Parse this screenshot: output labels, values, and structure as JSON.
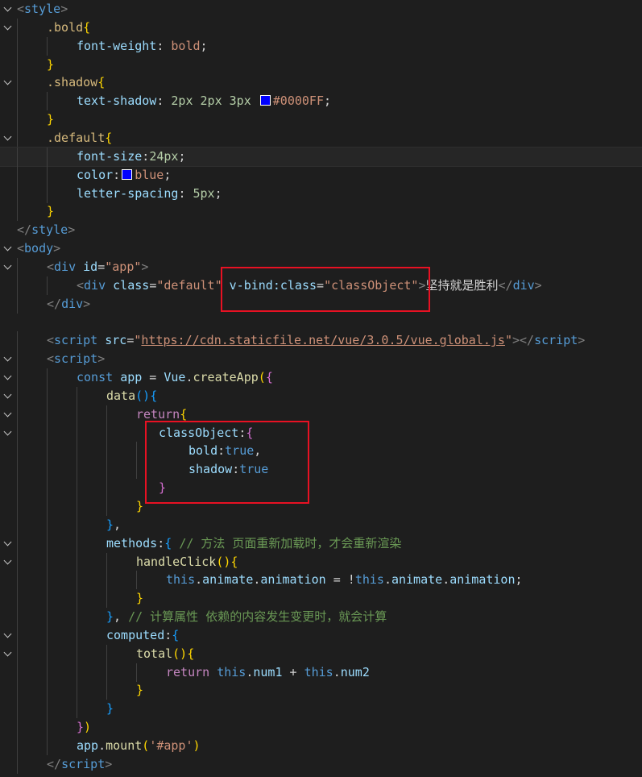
{
  "colors": {
    "swatch_shadow": "#0000FF",
    "swatch_color": "#0000ff",
    "highlight_box": "#e81123"
  },
  "icons": {
    "fold": "chevron-down-icon"
  },
  "lines": [
    {
      "fold": true,
      "indent": 0,
      "tokens": [
        [
          "t-br",
          "<"
        ],
        [
          "t-tag",
          "style"
        ],
        [
          "t-br",
          ">"
        ]
      ]
    },
    {
      "fold": true,
      "indent": 1,
      "tokens": [
        [
          "t-sel",
          ".bold"
        ],
        [
          "t-p1",
          "{"
        ]
      ]
    },
    {
      "fold": false,
      "indent": 2,
      "tokens": [
        [
          "t-prop",
          "font-weight"
        ],
        [
          "t-text",
          ": "
        ],
        [
          "t-val",
          "bold"
        ],
        [
          "t-text",
          ";"
        ]
      ]
    },
    {
      "fold": false,
      "indent": 1,
      "tokens": [
        [
          "t-p1",
          "}"
        ]
      ]
    },
    {
      "fold": true,
      "indent": 1,
      "tokens": [
        [
          "t-sel",
          ".shadow"
        ],
        [
          "t-p1",
          "{"
        ]
      ]
    },
    {
      "fold": false,
      "indent": 2,
      "tokens": [
        [
          "t-prop",
          "text-shadow"
        ],
        [
          "t-text",
          ": "
        ],
        [
          "t-num",
          "2px"
        ],
        [
          "t-text",
          " "
        ],
        [
          "t-num",
          "2px"
        ],
        [
          "t-text",
          " "
        ],
        [
          "t-num",
          "3px"
        ],
        [
          "t-text",
          " "
        ],
        [
          "swatch",
          "swatch_shadow"
        ],
        [
          "t-val",
          "#0000FF"
        ],
        [
          "t-text",
          ";"
        ]
      ]
    },
    {
      "fold": false,
      "indent": 1,
      "tokens": [
        [
          "t-p1",
          "}"
        ]
      ]
    },
    {
      "fold": true,
      "indent": 1,
      "tokens": [
        [
          "t-sel",
          ".default"
        ],
        [
          "t-p1",
          "{"
        ]
      ]
    },
    {
      "fold": false,
      "indent": 2,
      "active": true,
      "tokens": [
        [
          "t-prop",
          "font-size"
        ],
        [
          "t-text",
          ":"
        ],
        [
          "t-num",
          "24px"
        ],
        [
          "t-text",
          ";"
        ]
      ]
    },
    {
      "fold": false,
      "indent": 2,
      "tokens": [
        [
          "t-prop",
          "color"
        ],
        [
          "t-text",
          ":"
        ],
        [
          "swatch",
          "swatch_color"
        ],
        [
          "t-val",
          "blue"
        ],
        [
          "t-text",
          ";"
        ]
      ]
    },
    {
      "fold": false,
      "indent": 2,
      "tokens": [
        [
          "t-prop",
          "letter-spacing"
        ],
        [
          "t-text",
          ": "
        ],
        [
          "t-num",
          "5px"
        ],
        [
          "t-text",
          ";"
        ]
      ]
    },
    {
      "fold": false,
      "indent": 1,
      "tokens": [
        [
          "t-p1",
          "}"
        ]
      ]
    },
    {
      "fold": false,
      "indent": 0,
      "tokens": [
        [
          "t-br",
          "</"
        ],
        [
          "t-tag",
          "style"
        ],
        [
          "t-br",
          ">"
        ]
      ]
    },
    {
      "fold": true,
      "indent": 0,
      "tokens": [
        [
          "t-br",
          "<"
        ],
        [
          "t-tag",
          "body"
        ],
        [
          "t-br",
          ">"
        ]
      ]
    },
    {
      "fold": true,
      "indent": 1,
      "tokens": [
        [
          "t-br",
          "<"
        ],
        [
          "t-tag",
          "div"
        ],
        [
          "t-text",
          " "
        ],
        [
          "t-attr",
          "id"
        ],
        [
          "t-text",
          "="
        ],
        [
          "t-str",
          "\"app\""
        ],
        [
          "t-br",
          ">"
        ]
      ]
    },
    {
      "fold": false,
      "indent": 2,
      "tokens": [
        [
          "t-br",
          "<"
        ],
        [
          "t-tag",
          "div"
        ],
        [
          "t-text",
          " "
        ],
        [
          "t-attr",
          "class"
        ],
        [
          "t-text",
          "="
        ],
        [
          "t-str",
          "\"default\""
        ],
        [
          "t-text",
          " "
        ],
        [
          "t-attr",
          "v-bind:class"
        ],
        [
          "t-text",
          "="
        ],
        [
          "t-str",
          "\"classObject\""
        ],
        [
          "t-br",
          ">"
        ],
        [
          "t-text",
          "坚持就是胜利"
        ],
        [
          "t-br",
          "</"
        ],
        [
          "t-tag",
          "div"
        ],
        [
          "t-br",
          ">"
        ]
      ]
    },
    {
      "fold": false,
      "indent": 1,
      "tokens": [
        [
          "t-br",
          "</"
        ],
        [
          "t-tag",
          "div"
        ],
        [
          "t-br",
          ">"
        ]
      ]
    },
    {
      "fold": false,
      "indent": 0,
      "tokens": []
    },
    {
      "fold": false,
      "indent": 1,
      "tokens": [
        [
          "t-br",
          "<"
        ],
        [
          "t-tag",
          "script"
        ],
        [
          "t-text",
          " "
        ],
        [
          "t-attr",
          "src"
        ],
        [
          "t-text",
          "="
        ],
        [
          "t-str",
          "\""
        ],
        [
          "t-url",
          "https://cdn.staticfile.net/vue/3.0.5/vue.global.js"
        ],
        [
          "t-str",
          "\""
        ],
        [
          "t-br",
          "></"
        ],
        [
          "t-tag",
          "script"
        ],
        [
          "t-br",
          ">"
        ]
      ]
    },
    {
      "fold": true,
      "indent": 1,
      "tokens": [
        [
          "t-br",
          "<"
        ],
        [
          "t-tag",
          "script"
        ],
        [
          "t-br",
          ">"
        ]
      ]
    },
    {
      "fold": true,
      "indent": 2,
      "tokens": [
        [
          "t-kw",
          "const"
        ],
        [
          "t-text",
          " "
        ],
        [
          "t-var",
          "app"
        ],
        [
          "t-text",
          " = "
        ],
        [
          "t-var",
          "Vue"
        ],
        [
          "t-text",
          "."
        ],
        [
          "t-fn",
          "createApp"
        ],
        [
          "t-p1",
          "("
        ],
        [
          "t-p2",
          "{"
        ]
      ]
    },
    {
      "fold": true,
      "indent": 3,
      "tokens": [
        [
          "t-fn",
          "data"
        ],
        [
          "t-p3",
          "()"
        ],
        [
          "t-p3",
          "{"
        ]
      ]
    },
    {
      "fold": true,
      "indent": 4,
      "tokens": [
        [
          "t-ctrl",
          "return"
        ],
        [
          "t-p1",
          "{"
        ]
      ]
    },
    {
      "fold": true,
      "indent": 4,
      "extra": 28,
      "tokens": [
        [
          "t-var",
          "classObject"
        ],
        [
          "t-text",
          ":"
        ],
        [
          "t-p2",
          "{"
        ]
      ]
    },
    {
      "fold": false,
      "indent": 5,
      "extra": 28,
      "tokens": [
        [
          "t-var",
          "bold"
        ],
        [
          "t-text",
          ":"
        ],
        [
          "t-kw",
          "true"
        ],
        [
          "t-text",
          ","
        ]
      ]
    },
    {
      "fold": false,
      "indent": 5,
      "extra": 28,
      "tokens": [
        [
          "t-var",
          "shadow"
        ],
        [
          "t-text",
          ":"
        ],
        [
          "t-kw",
          "true"
        ]
      ]
    },
    {
      "fold": false,
      "indent": 4,
      "extra": 28,
      "tokens": [
        [
          "t-p2",
          "}"
        ]
      ]
    },
    {
      "fold": false,
      "indent": 4,
      "tokens": [
        [
          "t-p1",
          "}"
        ]
      ]
    },
    {
      "fold": false,
      "indent": 3,
      "tokens": [
        [
          "t-p3",
          "}"
        ],
        [
          "t-text",
          ","
        ]
      ]
    },
    {
      "fold": true,
      "indent": 3,
      "tokens": [
        [
          "t-var",
          "methods"
        ],
        [
          "t-text",
          ":"
        ],
        [
          "t-p3",
          "{"
        ],
        [
          "t-text",
          " "
        ],
        [
          "t-cmt",
          "// 方法 页面重新加载时，才会重新渲染"
        ]
      ]
    },
    {
      "fold": true,
      "indent": 4,
      "tokens": [
        [
          "t-fn",
          "handleClick"
        ],
        [
          "t-p1",
          "()"
        ],
        [
          "t-p1",
          "{"
        ]
      ]
    },
    {
      "fold": false,
      "indent": 5,
      "tokens": [
        [
          "t-kw",
          "this"
        ],
        [
          "t-text",
          "."
        ],
        [
          "t-var",
          "animate"
        ],
        [
          "t-text",
          "."
        ],
        [
          "t-var",
          "animation"
        ],
        [
          "t-text",
          " = !"
        ],
        [
          "t-kw",
          "this"
        ],
        [
          "t-text",
          "."
        ],
        [
          "t-var",
          "animate"
        ],
        [
          "t-text",
          "."
        ],
        [
          "t-var",
          "animation"
        ],
        [
          "t-text",
          ";"
        ]
      ]
    },
    {
      "fold": false,
      "indent": 4,
      "tokens": [
        [
          "t-p1",
          "}"
        ]
      ]
    },
    {
      "fold": false,
      "indent": 3,
      "tokens": [
        [
          "t-p3",
          "}"
        ],
        [
          "t-text",
          ", "
        ],
        [
          "t-cmt",
          "// 计算属性 依赖的内容发生变更时，就会计算"
        ]
      ]
    },
    {
      "fold": true,
      "indent": 3,
      "tokens": [
        [
          "t-var",
          "computed"
        ],
        [
          "t-text",
          ":"
        ],
        [
          "t-p3",
          "{"
        ]
      ]
    },
    {
      "fold": true,
      "indent": 4,
      "tokens": [
        [
          "t-fn",
          "total"
        ],
        [
          "t-p1",
          "()"
        ],
        [
          "t-p1",
          "{"
        ]
      ]
    },
    {
      "fold": false,
      "indent": 5,
      "tokens": [
        [
          "t-ctrl",
          "return"
        ],
        [
          "t-text",
          " "
        ],
        [
          "t-kw",
          "this"
        ],
        [
          "t-text",
          "."
        ],
        [
          "t-var",
          "num1"
        ],
        [
          "t-text",
          " + "
        ],
        [
          "t-kw",
          "this"
        ],
        [
          "t-text",
          "."
        ],
        [
          "t-var",
          "num2"
        ]
      ]
    },
    {
      "fold": false,
      "indent": 4,
      "tokens": [
        [
          "t-p1",
          "}"
        ]
      ]
    },
    {
      "fold": false,
      "indent": 3,
      "tokens": [
        [
          "t-p3",
          "}"
        ]
      ]
    },
    {
      "fold": false,
      "indent": 2,
      "tokens": [
        [
          "t-p2",
          "}"
        ],
        [
          "t-p1",
          ")"
        ]
      ]
    },
    {
      "fold": false,
      "indent": 2,
      "tokens": [
        [
          "t-var",
          "app"
        ],
        [
          "t-text",
          "."
        ],
        [
          "t-fn",
          "mount"
        ],
        [
          "t-p1",
          "("
        ],
        [
          "t-str",
          "'#app'"
        ],
        [
          "t-p1",
          ")"
        ]
      ]
    },
    {
      "fold": false,
      "indent": 1,
      "tokens": [
        [
          "t-br",
          "</"
        ],
        [
          "t-tag",
          "script"
        ],
        [
          "t-br",
          ">"
        ]
      ]
    }
  ]
}
